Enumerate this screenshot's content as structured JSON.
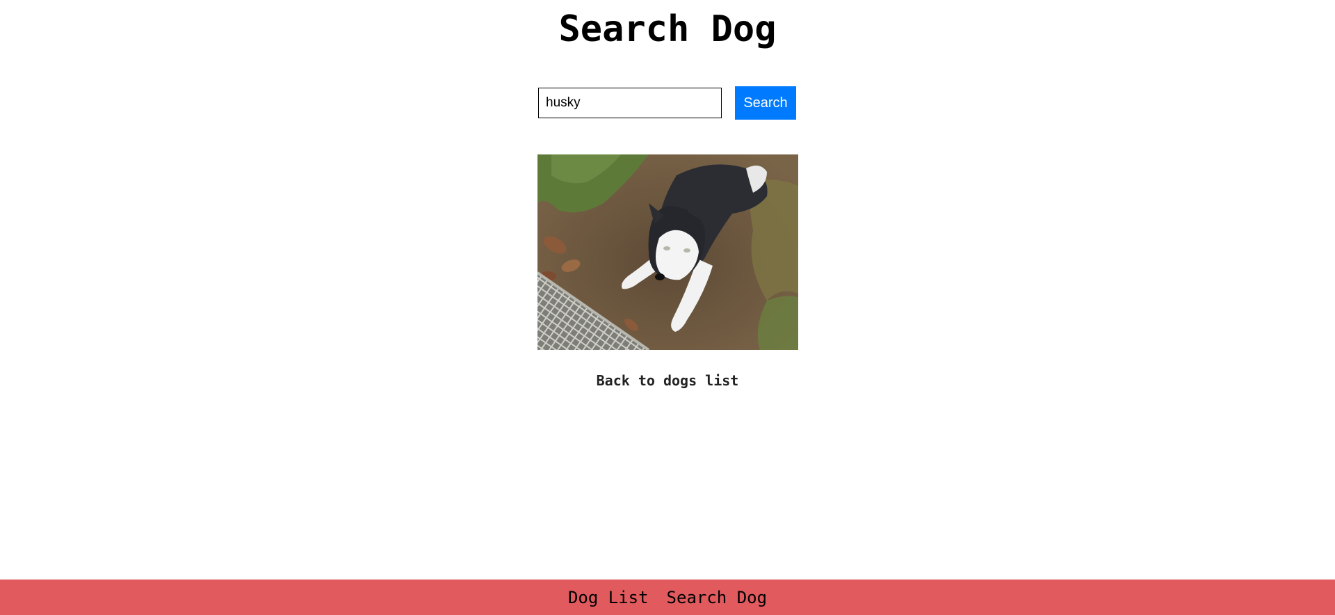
{
  "page": {
    "title": "Search Dog"
  },
  "search": {
    "value": "husky",
    "button_label": "Search"
  },
  "result": {
    "image_alt": "husky",
    "back_link": "Back to dogs list"
  },
  "footer": {
    "links": [
      {
        "label": "Dog List"
      },
      {
        "label": "Search Dog"
      }
    ]
  },
  "colors": {
    "button": "#007bff",
    "footer": "#e05a5e"
  }
}
